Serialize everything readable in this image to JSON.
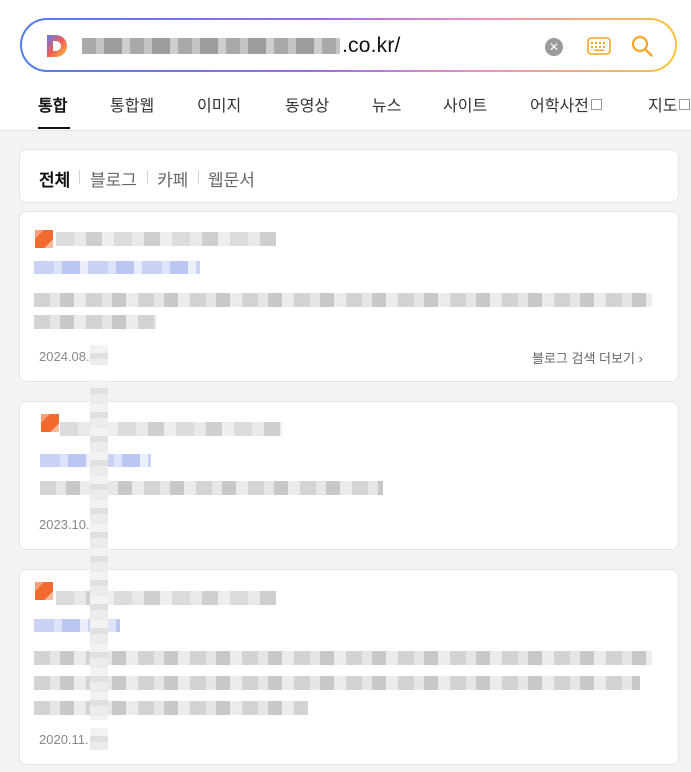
{
  "search": {
    "query_visible_suffix": ".co.kr/",
    "clear_icon": "close-circle-icon",
    "keyboard_icon": "keyboard-icon",
    "search_icon": "search-icon",
    "logo": "D",
    "accent_color": "#f5a623"
  },
  "tabs": [
    {
      "label": "통합",
      "active": true
    },
    {
      "label": "통합웹"
    },
    {
      "label": "이미지"
    },
    {
      "label": "동영상"
    },
    {
      "label": "뉴스"
    },
    {
      "label": "사이트"
    },
    {
      "label": "어학사전"
    },
    {
      "label": "지도"
    }
  ],
  "filters": [
    {
      "label": "전체",
      "active": true
    },
    {
      "label": "블로그"
    },
    {
      "label": "카페"
    },
    {
      "label": "웹문서"
    }
  ],
  "results": [
    {
      "date": "2024.08.",
      "more_label": "블로그 검색 더보기"
    },
    {
      "date": "2023.10."
    },
    {
      "date": "2020.11."
    }
  ]
}
